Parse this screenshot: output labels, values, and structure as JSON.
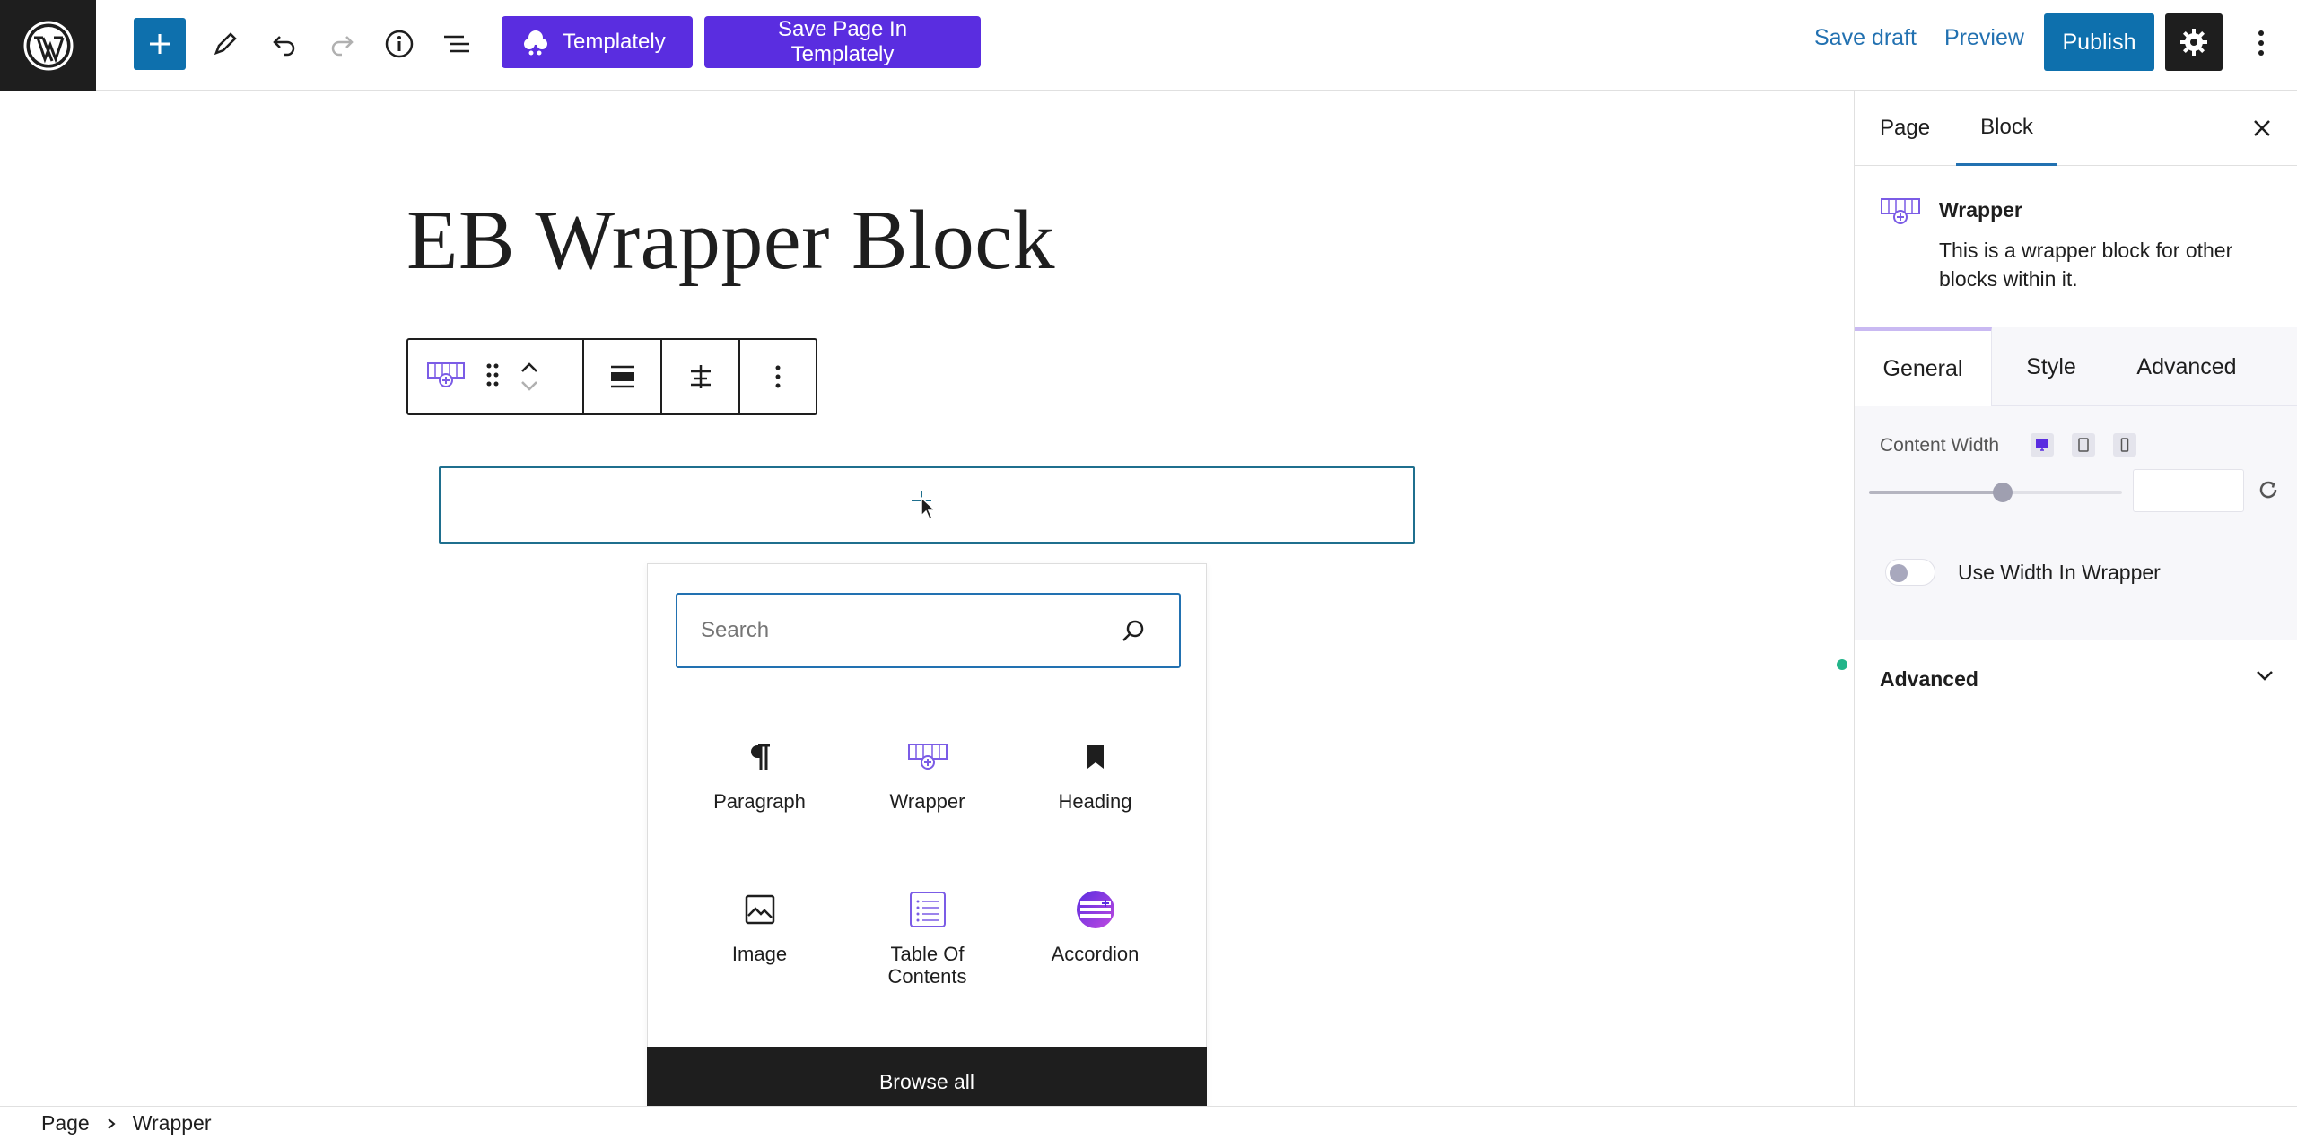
{
  "toolbar": {
    "templately_label": "Templately",
    "save_in_templately_label": "Save Page In Templately",
    "save_draft_label": "Save draft",
    "preview_label": "Preview",
    "publish_label": "Publish"
  },
  "editor": {
    "page_title": "EB Wrapper Block"
  },
  "inserter": {
    "search_placeholder": "Search",
    "blocks": [
      {
        "label": "Paragraph",
        "icon": "paragraph-icon"
      },
      {
        "label": "Wrapper",
        "icon": "wrapper-icon"
      },
      {
        "label": "Heading",
        "icon": "heading-bookmark-icon"
      },
      {
        "label": "Image",
        "icon": "image-icon"
      },
      {
        "label": "Table Of Contents",
        "icon": "table-of-contents-icon"
      },
      {
        "label": "Accordion",
        "icon": "accordion-icon"
      }
    ],
    "browse_all_label": "Browse all"
  },
  "sidebar": {
    "tabs": [
      "Page",
      "Block"
    ],
    "active_tab": "Block",
    "block_name": "Wrapper",
    "block_description": "This is a wrapper block for other blocks within it.",
    "panel_tabs": [
      "General",
      "Style",
      "Advanced"
    ],
    "active_panel_tab": "General",
    "content_width_label": "Content Width",
    "content_width_slider": 0.53,
    "use_width_label": "Use Width In Wrapper",
    "use_width_enabled": false,
    "advanced_section_label": "Advanced"
  },
  "breadcrumb": [
    "Page",
    "Wrapper"
  ],
  "colors": {
    "wp_blue": "#0e70ad",
    "link_blue": "#2271b1",
    "templately_purple": "#5a2de0",
    "eb_purple": "#7b5ce6",
    "dark": "#1e1e1e"
  }
}
